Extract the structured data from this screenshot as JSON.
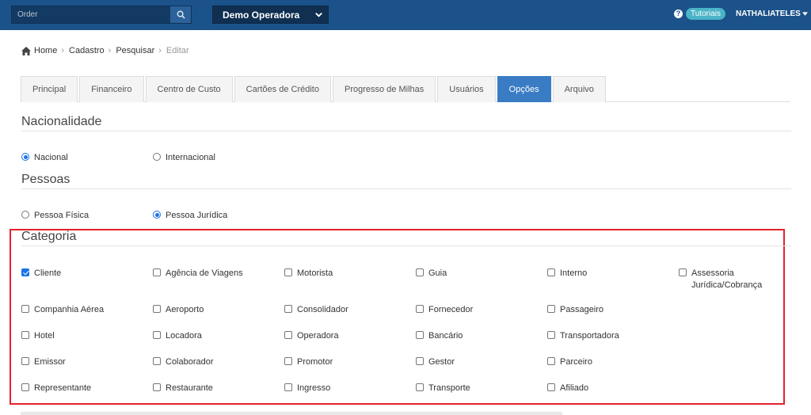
{
  "navbar": {
    "search_placeholder": "Order",
    "operator": "Demo Operadora",
    "tutorials": "Tutoriais",
    "user": "NATHALIATELES"
  },
  "breadcrumb": {
    "items": [
      "Home",
      "Cadastro",
      "Pesquisar"
    ],
    "current": "Editar"
  },
  "tabs": [
    "Principal",
    "Financeiro",
    "Centro de Custo",
    "Cartões de Crédito",
    "Progresso de Milhas",
    "Usuários",
    "Opções",
    "Arquivo"
  ],
  "active_tab": "Opções",
  "nacionalidade": {
    "title": "Nacionalidade",
    "options": [
      {
        "label": "Nacional",
        "checked": true
      },
      {
        "label": "Internacional",
        "checked": false
      }
    ]
  },
  "pessoas": {
    "title": "Pessoas",
    "options": [
      {
        "label": "Pessoa Física",
        "checked": false
      },
      {
        "label": "Pessoa Jurídica",
        "checked": true
      }
    ]
  },
  "categoria": {
    "title": "Categoria",
    "options": [
      {
        "label": "Cliente",
        "checked": true
      },
      {
        "label": "Agência de Viagens",
        "checked": false
      },
      {
        "label": "Motorista",
        "checked": false
      },
      {
        "label": "Guia",
        "checked": false
      },
      {
        "label": "Interno",
        "checked": false
      },
      {
        "label": "Assessoria Jurídica/Cobrança",
        "checked": false
      },
      {
        "label": "Companhia Aérea",
        "checked": false
      },
      {
        "label": "Aeroporto",
        "checked": false
      },
      {
        "label": "Consolidador",
        "checked": false
      },
      {
        "label": "Fornecedor",
        "checked": false
      },
      {
        "label": "Passageiro",
        "checked": false
      },
      {
        "label": "Hotel",
        "checked": false
      },
      {
        "label": "Locadora",
        "checked": false
      },
      {
        "label": "Operadora",
        "checked": false
      },
      {
        "label": "Bancário",
        "checked": false
      },
      {
        "label": "Transportadora",
        "checked": false
      },
      {
        "label": "Emissor",
        "checked": false
      },
      {
        "label": "Colaborador",
        "checked": false
      },
      {
        "label": "Promotor",
        "checked": false
      },
      {
        "label": "Gestor",
        "checked": false
      },
      {
        "label": "Parceiro",
        "checked": false
      },
      {
        "label": "Representante",
        "checked": false
      },
      {
        "label": "Restaurante",
        "checked": false
      },
      {
        "label": "Ingresso",
        "checked": false
      },
      {
        "label": "Transporte",
        "checked": false
      },
      {
        "label": "Afiliado",
        "checked": false
      }
    ]
  },
  "colors": {
    "navbar": "#1b5289",
    "active_tab": "#3a7cc4",
    "highlight": "#e2222d",
    "check": "#1a73e8"
  }
}
